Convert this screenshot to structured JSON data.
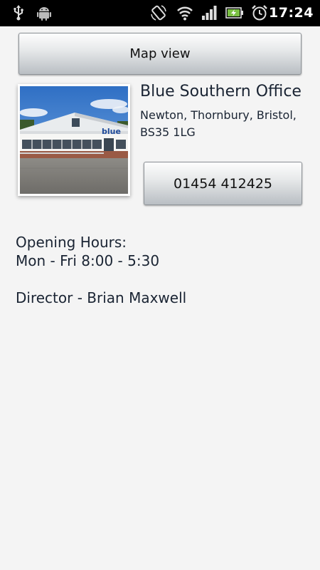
{
  "status_bar": {
    "time": "17:24",
    "icons": [
      "usb-icon",
      "android-debug-icon",
      "screen-rotate-icon",
      "wifi-icon",
      "signal-icon",
      "battery-charging-icon",
      "alarm-clock-icon"
    ],
    "color": "#000000"
  },
  "map_button": {
    "label": "Map view"
  },
  "office": {
    "name": "Blue Southern Office",
    "address_line1": "Newton, Thornbury, Bristol,",
    "address_line2": "BS35 1LG",
    "photo_sign_text": "blue"
  },
  "phone_button": {
    "label": "01454 412425"
  },
  "details": {
    "opening_hours_label": "Opening Hours:",
    "opening_hours_value": "Mon - Fri 8:00 - 5:30",
    "director": "Director - Brian Maxwell"
  },
  "colors": {
    "text": "#1a2433",
    "background": "#f4f4f4"
  }
}
